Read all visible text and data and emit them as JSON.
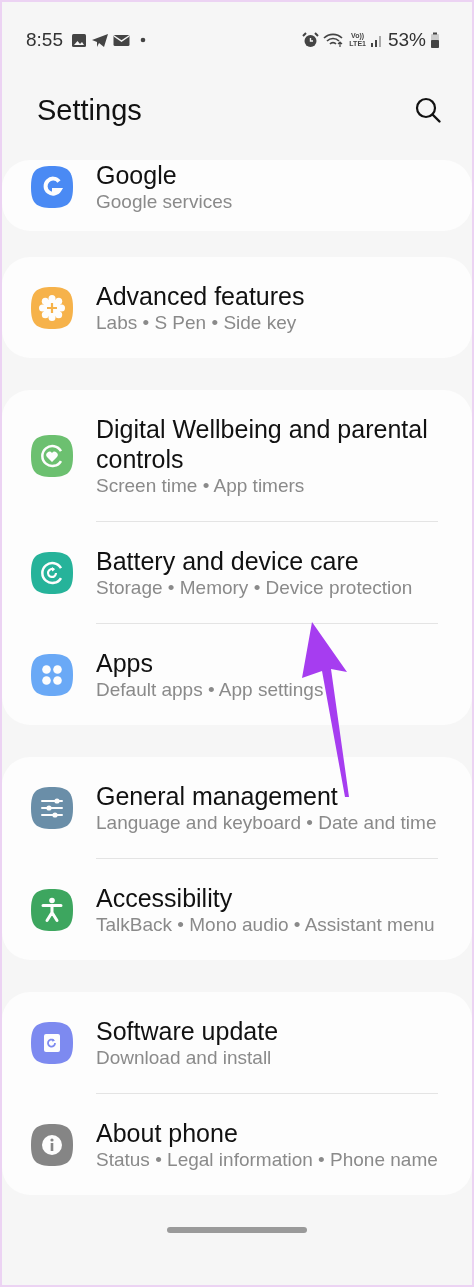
{
  "status_bar": {
    "time": "8:55",
    "volte": "Vo))",
    "network": "LTE1",
    "battery": "53%"
  },
  "header": {
    "title": "Settings"
  },
  "groups": [
    {
      "items": [
        {
          "kind": "google",
          "color": "#4a8af4",
          "title": "Google",
          "subtitle": "Google services"
        }
      ]
    },
    {
      "items": [
        {
          "kind": "advanced",
          "color": "#f6b24a",
          "title": "Advanced features",
          "subtitle": "Labs • S Pen • Side key"
        }
      ]
    },
    {
      "items": [
        {
          "kind": "wellbeing",
          "color": "#6cc070",
          "title": "Digital Wellbeing and parental controls",
          "subtitle": "Screen time • App timers"
        },
        {
          "kind": "battery",
          "color": "#26b39a",
          "title": "Battery and device care",
          "subtitle": "Storage • Memory • Device protection"
        },
        {
          "kind": "apps",
          "color": "#6aa9f6",
          "title": "Apps",
          "subtitle": "Default apps • App settings"
        }
      ]
    },
    {
      "items": [
        {
          "kind": "general",
          "color": "#6a8ea8",
          "title": "General management",
          "subtitle": "Language and keyboard • Date and time"
        },
        {
          "kind": "accessibility",
          "color": "#3da65f",
          "title": "Accessibility",
          "subtitle": "TalkBack • Mono audio • Assistant menu"
        }
      ]
    },
    {
      "items": [
        {
          "kind": "update",
          "color": "#7d8af0",
          "title": "Software update",
          "subtitle": "Download and install"
        },
        {
          "kind": "about",
          "color": "#858585",
          "title": "About phone",
          "subtitle": "Status • Legal information • Phone name"
        }
      ]
    }
  ]
}
